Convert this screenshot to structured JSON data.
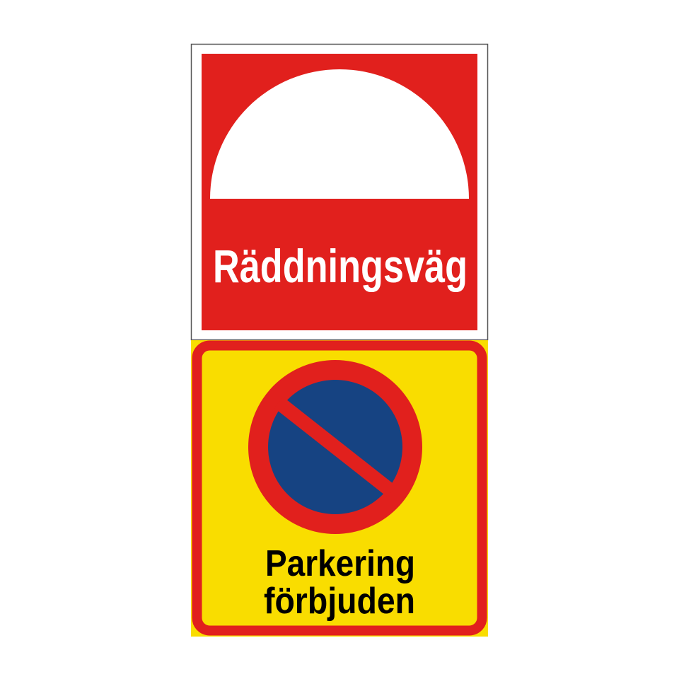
{
  "signs": {
    "top": {
      "label": "Räddningsväg",
      "colors": {
        "background": "#e1201d",
        "symbol": "#ffffff",
        "frame": "#555555"
      }
    },
    "bottom": {
      "line1": "Parkering",
      "line2": "förbjuden",
      "icon": "no-parking-icon",
      "colors": {
        "background": "#f9dd00",
        "border": "#e1201d",
        "disc": "#164382",
        "text": "#000000"
      }
    }
  }
}
